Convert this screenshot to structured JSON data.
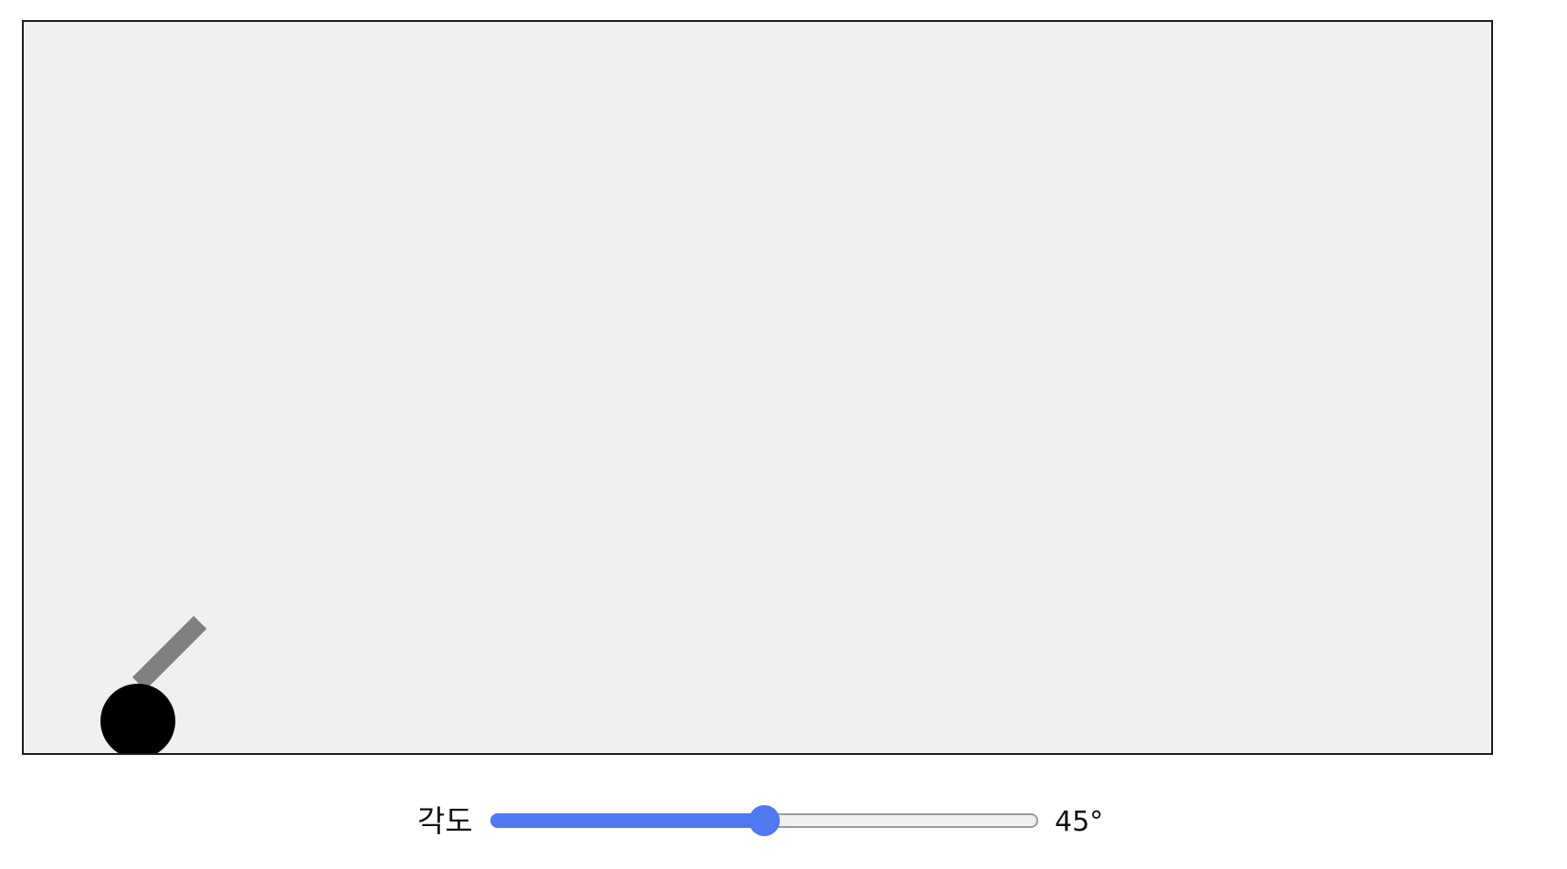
{
  "colors": {
    "stage_background": "#f0f0f0",
    "stage_border": "#1a1a1a",
    "cannon_body": "#000000",
    "cannon_barrel": "#808080",
    "slider_accent": "#5078f0",
    "slider_track": "#efefef"
  },
  "controls": {
    "angle_label": "각도",
    "angle": {
      "value": 45,
      "min": 0,
      "max": 90,
      "display": "45°"
    }
  }
}
